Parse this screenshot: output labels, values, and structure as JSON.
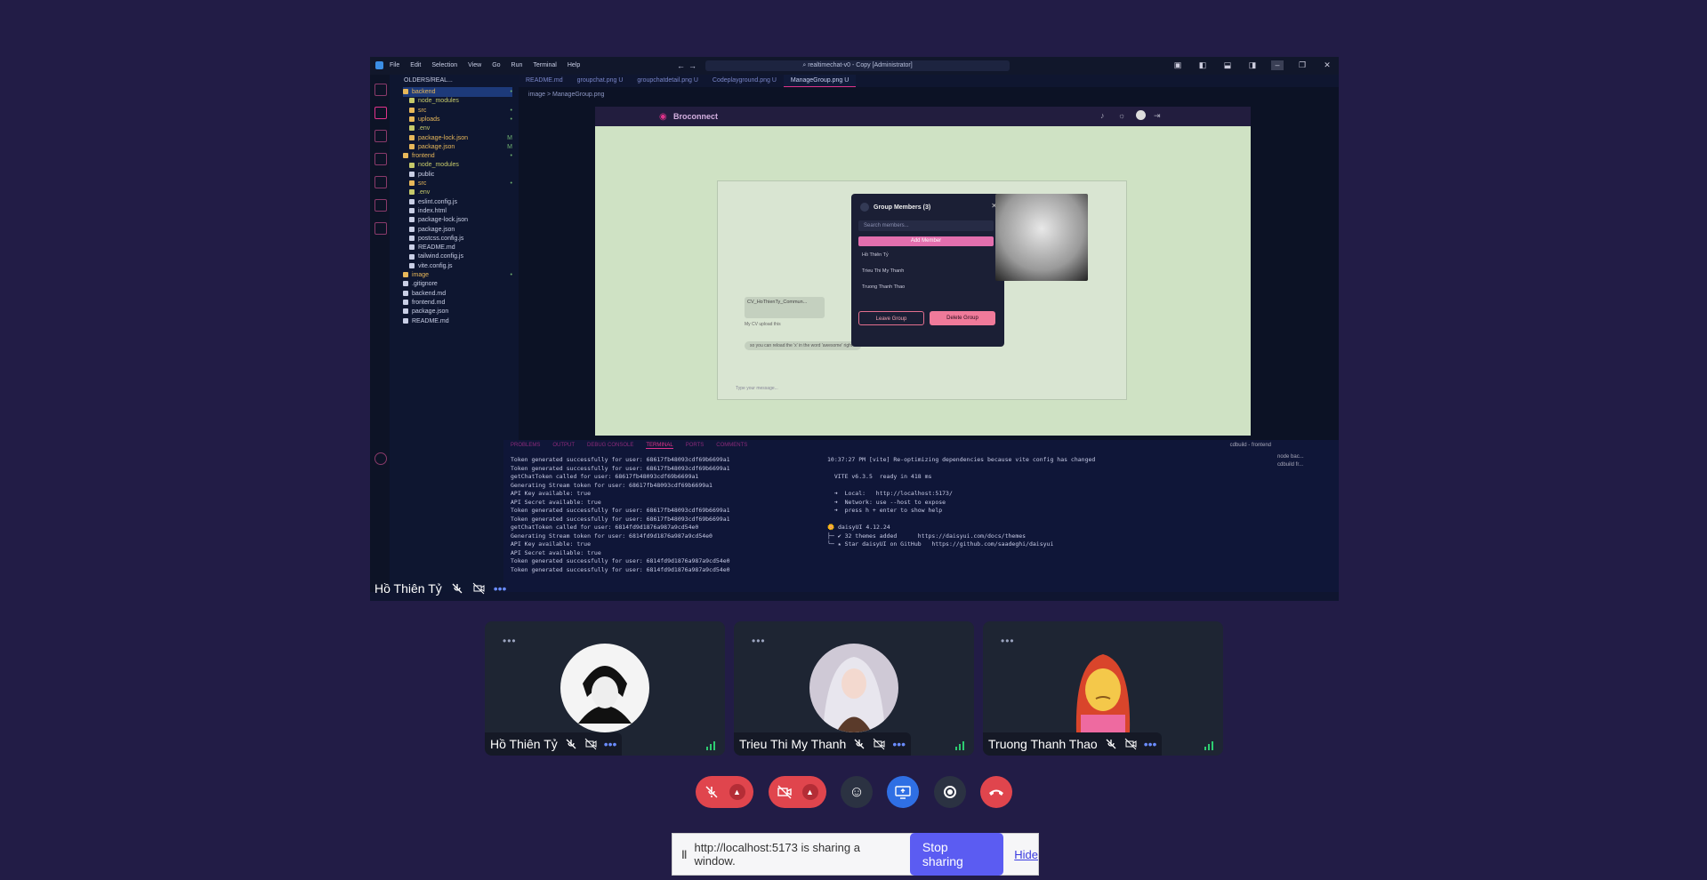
{
  "shared_window": {
    "title_bar": {
      "menu": [
        "File",
        "Edit",
        "Selection",
        "View",
        "Go",
        "Run",
        "Terminal",
        "Help"
      ],
      "command_center": "realtimechat-v0 - Copy [Administrator]"
    },
    "explorer": {
      "header": "OLDERS/REAL...",
      "items": [
        {
          "label": "backend",
          "color": "#e8b85a",
          "badge": "•"
        },
        {
          "label": "node_modules",
          "color": "#c5c96a",
          "badge": ""
        },
        {
          "label": "src",
          "color": "#e8b85a",
          "badge": "•"
        },
        {
          "label": "uploads",
          "color": "#e8b85a",
          "badge": "•"
        },
        {
          "label": ".env",
          "color": "#c5c96a",
          "badge": ""
        },
        {
          "label": "package-lock.json",
          "color": "#e8b85a",
          "badge": "M"
        },
        {
          "label": "package.json",
          "color": "#e8b85a",
          "badge": "M"
        },
        {
          "label": "frontend",
          "color": "#e8b85a",
          "badge": "•"
        },
        {
          "label": "node_modules",
          "color": "#c5c96a",
          "badge": ""
        },
        {
          "label": "public",
          "color": "#c9cfe6",
          "badge": ""
        },
        {
          "label": "src",
          "color": "#e8b85a",
          "badge": "•"
        },
        {
          "label": ".env",
          "color": "#c5c96a",
          "badge": ""
        },
        {
          "label": "eslint.config.js",
          "color": "#c9cfe6",
          "badge": ""
        },
        {
          "label": "index.html",
          "color": "#c9cfe6",
          "badge": ""
        },
        {
          "label": "package-lock.json",
          "color": "#c9cfe6",
          "badge": ""
        },
        {
          "label": "package.json",
          "color": "#c9cfe6",
          "badge": ""
        },
        {
          "label": "postcss.config.js",
          "color": "#c9cfe6",
          "badge": ""
        },
        {
          "label": "README.md",
          "color": "#c9cfe6",
          "badge": ""
        },
        {
          "label": "tailwind.config.js",
          "color": "#c9cfe6",
          "badge": ""
        },
        {
          "label": "vite.config.js",
          "color": "#c9cfe6",
          "badge": ""
        },
        {
          "label": "image",
          "color": "#e8b85a",
          "badge": "•"
        },
        {
          "label": ".gitignore",
          "color": "#c9cfe6",
          "badge": ""
        },
        {
          "label": "backend.md",
          "color": "#c9cfe6",
          "badge": ""
        },
        {
          "label": "frontend.md",
          "color": "#c9cfe6",
          "badge": ""
        },
        {
          "label": "package.json",
          "color": "#c9cfe6",
          "badge": ""
        },
        {
          "label": "README.md",
          "color": "#c9cfe6",
          "badge": ""
        }
      ]
    },
    "tabs": [
      "README.md",
      "groupchat.png U",
      "groupchatdetail.png U",
      "Codeplayground.png U",
      "ManageGroup.png U"
    ],
    "breadcrumb": "image > ManageGroup.png",
    "preview": {
      "brand": "Broconnect",
      "modal": {
        "title": "Group Members (3)",
        "search_placeholder": "Search members...",
        "add_button": "Add Member",
        "members": [
          "Hồ Thiên Tỷ",
          "Trieu Thi My Thanh",
          "Truong Thanh Thao"
        ],
        "leave_button": "Leave Group",
        "delete_button": "Delete Group"
      },
      "chat_card_title": "CV_HoThienTy_Commun...",
      "message_1": "My CV upload this",
      "message_2": "so you can reload the 'x' in the word 'awesome' right ?",
      "input_placeholder": "Type your message..."
    },
    "panel": {
      "tabs": [
        "PROBLEMS",
        "OUTPUT",
        "DEBUG CONSOLE",
        "TERMINAL",
        "PORTS",
        "COMMENTS"
      ],
      "active_tab": "TERMINAL",
      "terminal_title": "cdbuild - frontend",
      "left_terminal": [
        "Token generated successfully for user: 68617fb48093cdf69b6699a1",
        "Token generated successfully for user: 68617fb48093cdf69b6699a1",
        "getChatToken called for user: 68617fb48093cdf69b6699a1",
        "Generating Stream token for user: 68617fb48093cdf69b6699a1",
        "API Key available: true",
        "API Secret available: true",
        "Token generated successfully for user: 68617fb48093cdf69b6699a1",
        "Token generated successfully for user: 68617fb48093cdf69b6699a1",
        "getChatToken called for user: 6814fd9d1876a987a9cd54e0",
        "Generating Stream token for user: 6814fd9d1876a987a9cd54e0",
        "API Key available: true",
        "API Secret available: true",
        "Token generated successfully for user: 6814fd9d1876a987a9cd54e0",
        "Token generated successfully for user: 6814fd9d1876a987a9cd54e0"
      ],
      "right_terminal": [
        "10:37:27 PM [vite] Re-optimizing dependencies because vite config has changed",
        "",
        "  VITE v6.3.5  ready in 418 ms",
        "",
        "  ➜  Local:   http://localhost:5173/",
        "  ➜  Network: use --host to expose",
        "  ➜  press h + enter to show help",
        "",
        "🌼 daisyUI 4.12.24",
        "├─ ✔ 32 themes added      https://daisyui.com/docs/themes",
        "╰─ ★ Star daisyUI on GitHub   https://github.com/saadeghi/daisyui"
      ],
      "side_items": [
        "node bac...",
        "cdbuild fr..."
      ]
    },
    "presenter_name": "Hồ Thiên Tỷ"
  },
  "participants": [
    {
      "name": "Hồ Thiên Tỷ"
    },
    {
      "name": "Trieu Thi My Thanh"
    },
    {
      "name": "Truong Thanh Thao"
    }
  ],
  "controls": [
    "mute-mic",
    "stop-camera",
    "emoji-reaction",
    "share-screen",
    "record",
    "leave-call"
  ],
  "share_notice": {
    "text": "http://localhost:5173 is sharing a window.",
    "stop_label": "Stop sharing",
    "hide_label": "Hide"
  },
  "colors": {
    "background": "#221c46",
    "tile": "#1e2533",
    "danger": "#e0454d",
    "primary": "#2f6fe4",
    "accent": "#e0338a"
  }
}
